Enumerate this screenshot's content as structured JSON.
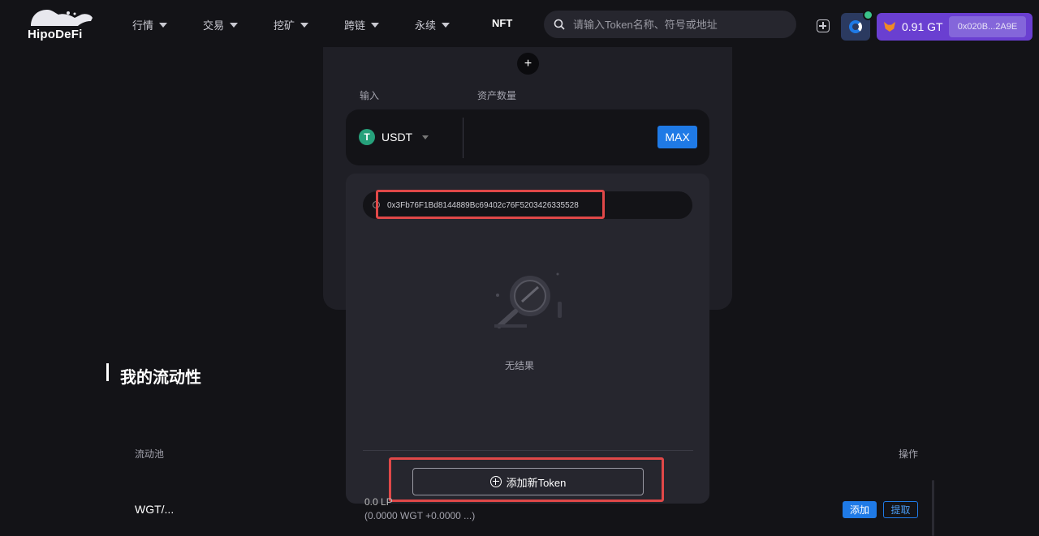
{
  "header": {
    "logo_text": "HipoDeFi",
    "nav": [
      "行情",
      "交易",
      "挖矿",
      "跨链",
      "永续"
    ],
    "nft": "NFT",
    "search_placeholder": "请输入Token名称、符号或地址",
    "wallet_balance": "0.91 GT",
    "wallet_address": "0x020B...2A9E"
  },
  "swap": {
    "plus": "+",
    "input_label": "输入",
    "amount_label": "资产数量",
    "token_symbol": "USDT",
    "token_icon_glyph": "T",
    "max_label": "MAX"
  },
  "selector": {
    "search_value": "0x3Fb76F1Bd8144889Bc69402c76F5203426335528",
    "no_result": "无结果",
    "add_token_label": "添加新Token"
  },
  "liquidity": {
    "title": "我的流动性",
    "col_pool": "流动池",
    "col_action": "操作",
    "row": {
      "pool": "WGT/...",
      "lp_amount": "0.0 LP",
      "lp_detail": "(0.0000 WGT +0.0000 ...)",
      "add": "添加",
      "withdraw": "提取"
    }
  },
  "colors": {
    "background": "#131317",
    "accent_blue": "#1f7ae6",
    "wallet_purple": "#6a3fd1",
    "highlight_red": "#e04848"
  }
}
